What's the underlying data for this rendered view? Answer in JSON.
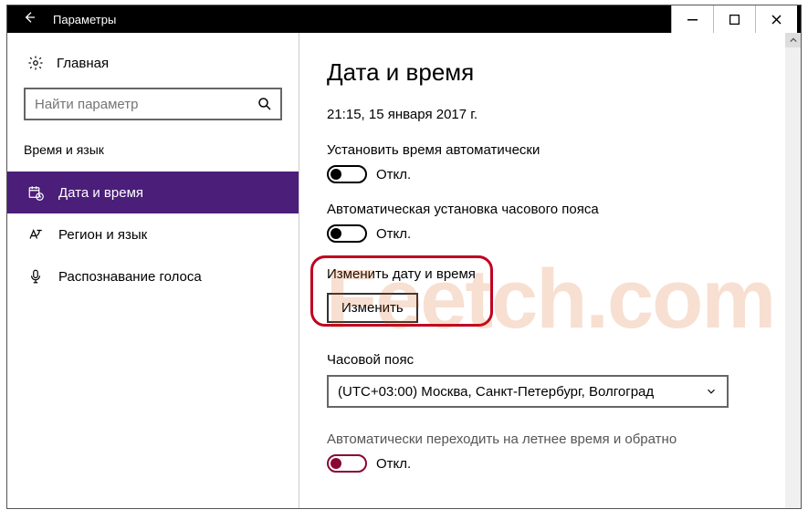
{
  "titlebar": {
    "title": "Параметры"
  },
  "sidebar": {
    "home": "Главная",
    "search_placeholder": "Найти параметр",
    "group": "Время и язык",
    "items": [
      {
        "label": "Дата и время"
      },
      {
        "label": "Регион и язык"
      },
      {
        "label": "Распознавание голоса"
      }
    ]
  },
  "content": {
    "heading": "Дата и время",
    "current": "21:15, 15 января 2017 г.",
    "auto_time_label": "Установить время автоматически",
    "auto_time_state": "Откл.",
    "auto_tz_label": "Автоматическая установка часового пояса",
    "auto_tz_state": "Откл.",
    "change_label": "Изменить дату и время",
    "change_button": "Изменить",
    "tz_label": "Часовой пояс",
    "tz_value": "(UTC+03:00) Москва, Санкт-Петербург, Волгоград",
    "dst_label": "Автоматически переходить на летнее время и обратно",
    "dst_state": "Откл."
  },
  "watermark": "Feetch.com"
}
